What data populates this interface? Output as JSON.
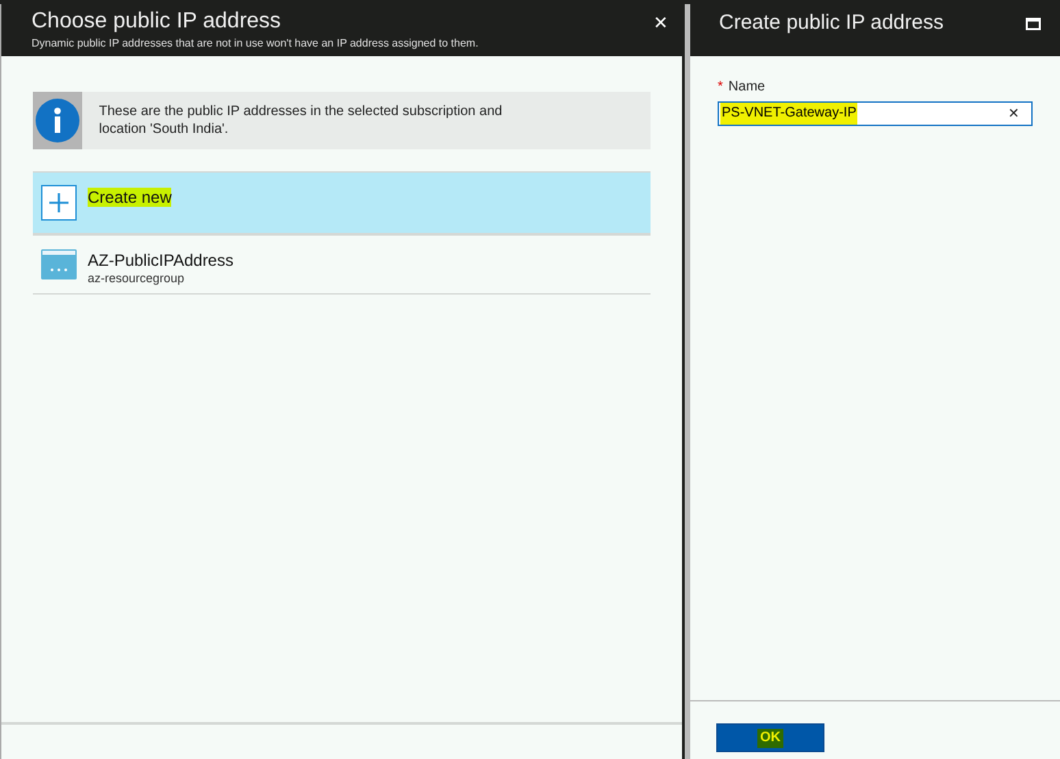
{
  "left_blade": {
    "title": "Choose public IP address",
    "subtitle": "Dynamic public IP addresses that are not in use won't have an IP address assigned to them.",
    "close": "✕",
    "info": "These are the public IP addresses in the selected subscription and location 'South India'.",
    "items": [
      {
        "kind": "create",
        "label": "Create new",
        "selected": true,
        "highlighted": true
      },
      {
        "kind": "resource",
        "label": "AZ-PublicIPAddress",
        "sublabel": "az-resourcegroup",
        "selected": false,
        "highlighted": false
      }
    ]
  },
  "right_blade": {
    "title": "Create public IP address",
    "name_field": {
      "required_mark": "*",
      "label": "Name",
      "value": "PS-VNET-Gateway-IP",
      "highlighted": true,
      "clear": "✕"
    },
    "ok_button": {
      "label": "OK",
      "highlighted": true
    }
  }
}
